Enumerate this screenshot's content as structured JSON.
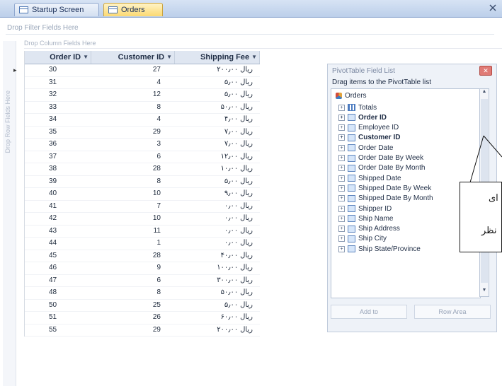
{
  "tabs": [
    {
      "label": "Startup Screen"
    },
    {
      "label": "Orders"
    }
  ],
  "zones": {
    "filter": "Drop Filter Fields Here",
    "column": "Drop Column Fields Here",
    "row": "Drop Row Fields Here"
  },
  "grid": {
    "headers": [
      "Order ID",
      "Customer ID",
      "Shipping Fee"
    ],
    "rows": [
      [
        "30",
        "27",
        "ریال ۲۰۰٫۰۰"
      ],
      [
        "31",
        "4",
        "ریال ۵٫۰۰"
      ],
      [
        "32",
        "12",
        "ریال ۵٫۰۰"
      ],
      [
        "33",
        "8",
        "ریال ۵۰٫۰۰"
      ],
      [
        "34",
        "4",
        "ریال ۴٫۰۰"
      ],
      [
        "35",
        "29",
        "ریال ۷٫۰۰"
      ],
      [
        "36",
        "3",
        "ریال ۷٫۰۰"
      ],
      [
        "37",
        "6",
        "ریال ۱۲٫۰۰"
      ],
      [
        "38",
        "28",
        "ریال ۱۰٫۰۰"
      ],
      [
        "39",
        "8",
        "ریال ۵٫۰۰"
      ],
      [
        "40",
        "10",
        "ریال ۹٫۰۰"
      ],
      [
        "41",
        "7",
        "ریال ۰٫۰۰"
      ],
      [
        "42",
        "10",
        "ریال ۰٫۰۰"
      ],
      [
        "43",
        "11",
        "ریال ۰٫۰۰"
      ],
      [
        "44",
        "1",
        "ریال ۰٫۰۰"
      ],
      [
        "45",
        "28",
        "ریال ۴۰٫۰۰"
      ],
      [
        "46",
        "9",
        "ریال ۱۰۰٫۰۰"
      ],
      [
        "47",
        "6",
        "ریال ۳۰۰٫۰۰"
      ],
      [
        "48",
        "8",
        "ریال ۵۰٫۰۰"
      ],
      [
        "50",
        "25",
        "ریال ۵٫۰۰"
      ],
      [
        "51",
        "26",
        "ریال ۶۰٫۰۰"
      ],
      [
        "55",
        "29",
        "ریال ۲۰۰٫۰۰"
      ]
    ]
  },
  "fieldlist": {
    "title": "PivotTable Field List",
    "hint": "Drag items to the PivotTable list",
    "root": "Orders",
    "items": [
      {
        "label": "Totals",
        "bold": false,
        "kind": "totals"
      },
      {
        "label": "Order ID",
        "bold": true,
        "kind": "field"
      },
      {
        "label": "Employee ID",
        "bold": false,
        "kind": "field"
      },
      {
        "label": "Customer ID",
        "bold": true,
        "kind": "field"
      },
      {
        "label": "Order Date",
        "bold": false,
        "kind": "field"
      },
      {
        "label": "Order Date By Week",
        "bold": false,
        "kind": "field"
      },
      {
        "label": "Order Date By Month",
        "bold": false,
        "kind": "field"
      },
      {
        "label": "Shipped Date",
        "bold": false,
        "kind": "field"
      },
      {
        "label": "Shipped Date By Week",
        "bold": false,
        "kind": "field"
      },
      {
        "label": "Shipped Date By Month",
        "bold": false,
        "kind": "field"
      },
      {
        "label": "Shipper ID",
        "bold": false,
        "kind": "field"
      },
      {
        "label": "Ship Name",
        "bold": false,
        "kind": "field"
      },
      {
        "label": "Ship Address",
        "bold": false,
        "kind": "field"
      },
      {
        "label": "Ship City",
        "bold": false,
        "kind": "field"
      },
      {
        "label": "Ship State/Province",
        "bold": false,
        "kind": "field"
      }
    ],
    "add_button": "Add to",
    "area_select": "Row Area"
  },
  "callout": {
    "line1": "ای",
    "line2": "نظر"
  }
}
